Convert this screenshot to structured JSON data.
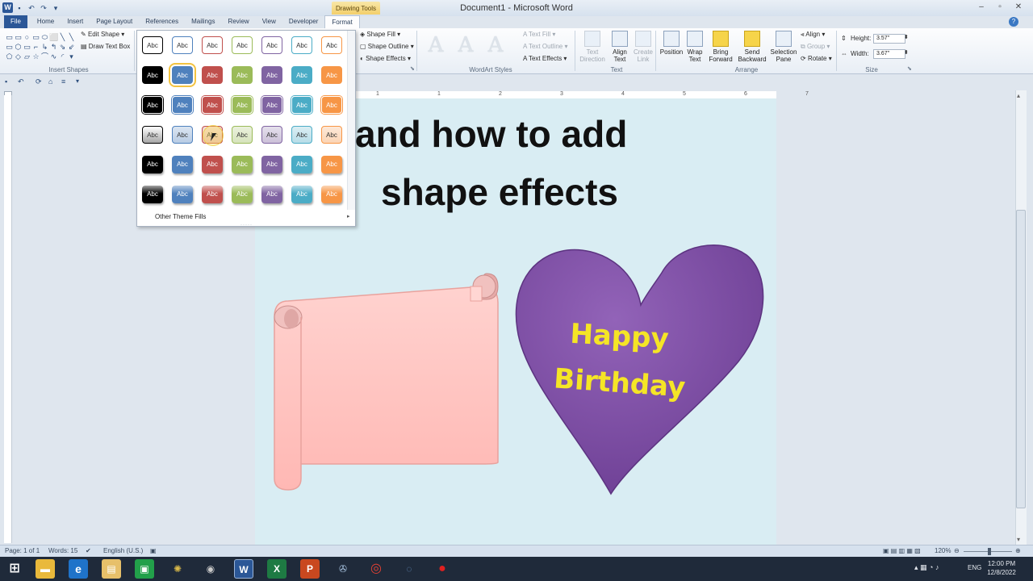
{
  "window": {
    "app_icon": "W",
    "title": "Document1 - Microsoft Word",
    "context_tab_group": "Drawing Tools",
    "controls": {
      "minimize": "–",
      "maximize": "▫",
      "close": "✕"
    }
  },
  "quick_access": [
    "save-icon",
    "undo-icon",
    "redo-icon",
    "customize-icon"
  ],
  "tabs": [
    {
      "label": "File",
      "active": false
    },
    {
      "label": "Home",
      "active": false
    },
    {
      "label": "Insert",
      "active": false
    },
    {
      "label": "Page Layout",
      "active": false
    },
    {
      "label": "References",
      "active": false
    },
    {
      "label": "Mailings",
      "active": false
    },
    {
      "label": "Review",
      "active": false
    },
    {
      "label": "View",
      "active": false
    },
    {
      "label": "Developer",
      "active": false
    },
    {
      "label": "Format",
      "active": true
    }
  ],
  "ribbon": {
    "insert_shapes": {
      "label": "Insert Shapes",
      "edit_shape": "Edit Shape",
      "draw_text_box": "Draw Text Box",
      "shapes": [
        "▭",
        "▭",
        "○",
        "▭",
        "⬭",
        "⬜",
        "╲",
        "╲",
        "▭",
        "⬡",
        "▭",
        "⌐",
        "↳",
        "↰",
        "⇘",
        "⇙",
        "⬠",
        "◇",
        "▱",
        "☆",
        "⌒",
        "∿",
        "◜",
        "▾"
      ]
    },
    "shape_styles": {
      "shape_fill": "Shape Fill",
      "shape_outline": "Shape Outline",
      "shape_effects": "Shape Effects"
    },
    "wordart_styles": {
      "label": "WordArt Styles",
      "letters": [
        "A",
        "A",
        "A"
      ],
      "text_fill": "Text Fill",
      "text_outline": "Text Outline",
      "text_effects": "Text Effects"
    },
    "text": {
      "label": "Text",
      "text_direction": "Text Direction",
      "align_text": "Align Text",
      "create_link": "Create Link"
    },
    "arrange": {
      "label": "Arrange",
      "position": "Position",
      "wrap_text": "Wrap Text",
      "bring_forward": "Bring Forward",
      "send_backward": "Send Backward",
      "selection_pane": "Selection Pane",
      "align": "Align",
      "group": "Group",
      "rotate": "Rotate"
    },
    "size": {
      "label": "Size",
      "height_label": "Height:",
      "height_value": "3.57\"",
      "width_label": "Width:",
      "width_value": "3.67\""
    }
  },
  "gallery": {
    "swatch_label": "Abc",
    "other_fills": "Other Theme Fills",
    "columns": [
      "#000000",
      "#4f81bd",
      "#c0504d",
      "#9bbb59",
      "#8064a2",
      "#4bacc6",
      "#f79646"
    ],
    "highlighted": {
      "row": 3,
      "col": 2
    },
    "selected": {
      "row": 1,
      "col": 1
    }
  },
  "ruler_numbers": [
    "1",
    "1",
    "2",
    "3",
    "4",
    "5",
    "6",
    "7"
  ],
  "document": {
    "heading_line1": "and how to add",
    "heading_line2": "shape effects",
    "heart_text_line1": "Happy",
    "heart_text_line2": "Birthday",
    "colors": {
      "page": "#d9edf3",
      "scroll": "#ffc7c4",
      "heart": "#7b4aa0",
      "heart_text": "#f5e526"
    }
  },
  "status": {
    "page": "Page: 1 of 1",
    "words": "Words: 15",
    "language": "English (U.S.)",
    "zoom": "120%"
  },
  "taskbar": {
    "time": "12:00 PM",
    "date": "12/8/2022",
    "lang": "ENG"
  }
}
